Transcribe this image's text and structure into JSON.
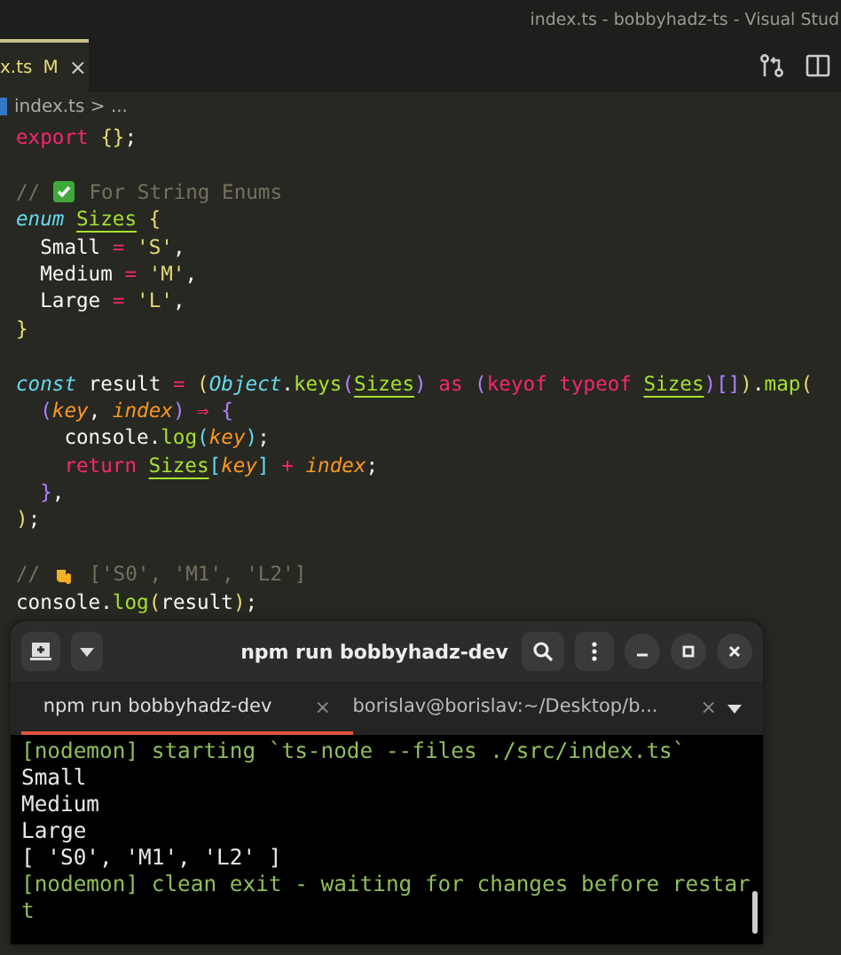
{
  "window": {
    "title": "index.ts - bobbyhadz-ts - Visual Stud"
  },
  "editor_tab": {
    "label": "x.ts",
    "status": "M",
    "close": "×",
    "selected": true
  },
  "breadcrumb": {
    "file": "index.ts",
    "separator": ">",
    "rest": "..."
  },
  "code": [
    {
      "tokens": [
        {
          "kind": "kw",
          "text": "export"
        },
        {
          "kind": "br",
          "text": " {}"
        },
        {
          "kind": "plain",
          "text": ";"
        }
      ]
    },
    {
      "gap_before": true,
      "tokens": [
        {
          "kind": "cm",
          "text": "// "
        },
        {
          "kind": "check-icon"
        },
        {
          "kind": "cm",
          "text": " For String Enums"
        }
      ]
    },
    {
      "tokens": [
        {
          "kind": "kwi",
          "text": "enum"
        },
        {
          "kind": "type",
          "text": "Sizes",
          "pad": true
        },
        {
          "kind": "br",
          "text": " {"
        }
      ]
    },
    {
      "tokens": [
        {
          "kind": "plain",
          "text": "  Small "
        },
        {
          "kind": "kw",
          "text": "="
        },
        {
          "kind": "str",
          "text": " 'S'"
        },
        {
          "kind": "plain",
          "text": ","
        }
      ]
    },
    {
      "tokens": [
        {
          "kind": "plain",
          "text": "  Medium "
        },
        {
          "kind": "kw",
          "text": "="
        },
        {
          "kind": "str",
          "text": " 'M'"
        },
        {
          "kind": "plain",
          "text": ","
        }
      ]
    },
    {
      "tokens": [
        {
          "kind": "plain",
          "text": "  Large "
        },
        {
          "kind": "kw",
          "text": "="
        },
        {
          "kind": "str",
          "text": " 'L'"
        },
        {
          "kind": "plain",
          "text": ","
        }
      ]
    },
    {
      "tokens": [
        {
          "kind": "br",
          "text": "}"
        }
      ]
    },
    {
      "gap_before": true,
      "tokens": [
        {
          "kind": "kwi",
          "text": "const"
        },
        {
          "kind": "plain",
          "text": " result "
        },
        {
          "kind": "kw",
          "text": "="
        },
        {
          "kind": "br",
          "text": " ("
        },
        {
          "kind": "ital",
          "text": "Object"
        },
        {
          "kind": "plain",
          "text": "."
        },
        {
          "kind": "fn",
          "text": "keys"
        },
        {
          "kind": "br2",
          "text": "("
        },
        {
          "kind": "type",
          "text": "Sizes"
        },
        {
          "kind": "br2",
          "text": ")"
        },
        {
          "kind": "kw",
          "text": " as"
        },
        {
          "kind": "br2",
          "text": " ("
        },
        {
          "kind": "kw",
          "text": "keyof typeof"
        },
        {
          "kind": "type",
          "text": "Sizes",
          "pad": true
        },
        {
          "kind": "br2",
          "text": ")[]"
        },
        {
          "kind": "br",
          "text": ")"
        },
        {
          "kind": "plain",
          "text": "."
        },
        {
          "kind": "fn",
          "text": "map"
        },
        {
          "kind": "br",
          "text": "("
        }
      ]
    },
    {
      "tokens": [
        {
          "kind": "br2",
          "text": "  ("
        },
        {
          "kind": "param",
          "text": "key"
        },
        {
          "kind": "plain",
          "text": ", "
        },
        {
          "kind": "param",
          "text": "index"
        },
        {
          "kind": "br2",
          "text": ")"
        },
        {
          "kind": "kw",
          "text": " ⇒"
        },
        {
          "kind": "br2",
          "text": " {"
        }
      ]
    },
    {
      "tokens": [
        {
          "kind": "plain",
          "text": "    console."
        },
        {
          "kind": "fn",
          "text": "log"
        },
        {
          "kind": "br3",
          "text": "("
        },
        {
          "kind": "param",
          "text": "key"
        },
        {
          "kind": "br3",
          "text": ")"
        },
        {
          "kind": "plain",
          "text": ";"
        }
      ]
    },
    {
      "tokens": [
        {
          "kind": "kw",
          "text": "    return"
        },
        {
          "kind": "type",
          "text": "Sizes",
          "pad": true
        },
        {
          "kind": "br3",
          "text": "["
        },
        {
          "kind": "param",
          "text": "key"
        },
        {
          "kind": "br3",
          "text": "]"
        },
        {
          "kind": "kw",
          "text": " +"
        },
        {
          "kind": "param",
          "text": " index"
        },
        {
          "kind": "plain",
          "text": ";"
        }
      ]
    },
    {
      "tokens": [
        {
          "kind": "br2",
          "text": "  }"
        },
        {
          "kind": "plain",
          "text": ","
        }
      ]
    },
    {
      "tokens": [
        {
          "kind": "br",
          "text": ")"
        },
        {
          "kind": "plain",
          "text": ";"
        }
      ]
    },
    {
      "gap_before": true,
      "tokens": [
        {
          "kind": "cm",
          "text": "// "
        },
        {
          "kind": "hand-icon"
        },
        {
          "kind": "cm",
          "text": " ['S0', 'M1', 'L2']"
        }
      ]
    },
    {
      "tokens": [
        {
          "kind": "plain",
          "text": "console."
        },
        {
          "kind": "fn",
          "text": "log"
        },
        {
          "kind": "br",
          "text": "("
        },
        {
          "kind": "plain",
          "text": "result"
        },
        {
          "kind": "br",
          "text": ")"
        },
        {
          "kind": "plain",
          "text": ";"
        }
      ]
    }
  ],
  "terminal": {
    "title": "npm run bobbyhadz-dev",
    "tabs": [
      {
        "label": "npm run bobbyhadz-dev",
        "close": "×",
        "selected": true
      },
      {
        "label": "borislav@borislav:~/Desktop/b...",
        "close": "×",
        "selected": false
      }
    ],
    "lines": [
      {
        "kind": "info",
        "text": "[nodemon] starting `ts-node --files ./src/index.ts`"
      },
      {
        "kind": "output",
        "text": "Small"
      },
      {
        "kind": "output",
        "text": "Medium"
      },
      {
        "kind": "output",
        "text": "Large"
      },
      {
        "kind": "output",
        "text": "[ 'S0', 'M1', 'L2' ]"
      },
      {
        "kind": "info",
        "text": "[nodemon] clean exit - waiting for changes before restar"
      },
      {
        "kind": "info",
        "text": "t"
      }
    ]
  }
}
